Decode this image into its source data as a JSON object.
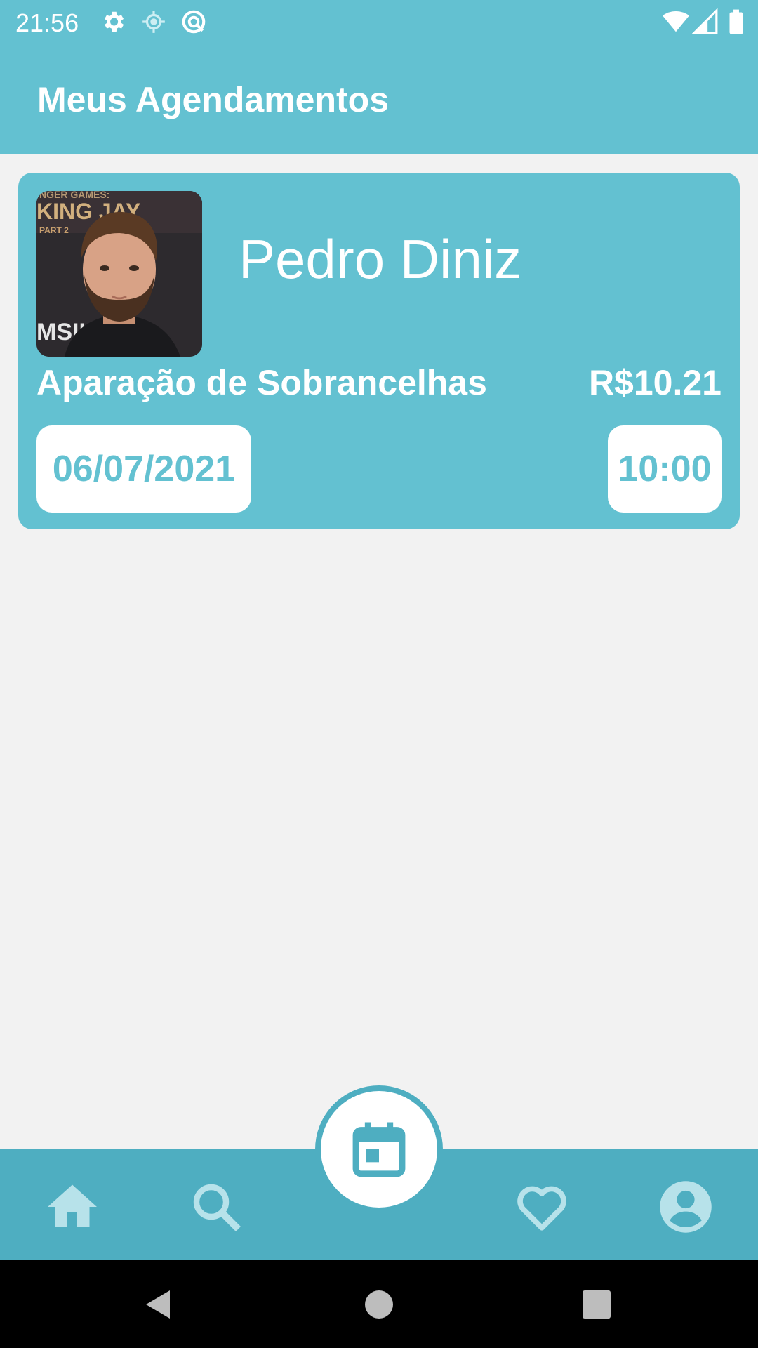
{
  "status_bar": {
    "time": "21:56",
    "icons": [
      "gear-icon",
      "location-icon",
      "data-saver-icon",
      "wifi-icon",
      "signal-icon",
      "battery-icon"
    ]
  },
  "app_bar": {
    "title": "Meus Agendamentos"
  },
  "appointment": {
    "provider_name": "Pedro Diniz",
    "service": "Aparação de Sobrancelhas",
    "price": "R$10.21",
    "date": "06/07/2021",
    "time": "10:00",
    "photo_poster_text": [
      "NGER GAMES:",
      "KING JAY",
      "PART 2",
      "MSII"
    ]
  },
  "bottom_nav": {
    "items": [
      "home-icon",
      "search-icon",
      "calendar-icon",
      "heart-icon",
      "account-icon"
    ],
    "active": "calendar-icon"
  },
  "colors": {
    "primary": "#63c1d1",
    "nav": "#4eaec1",
    "nav_icon": "#b7e2ea",
    "background": "#f2f2f2"
  }
}
